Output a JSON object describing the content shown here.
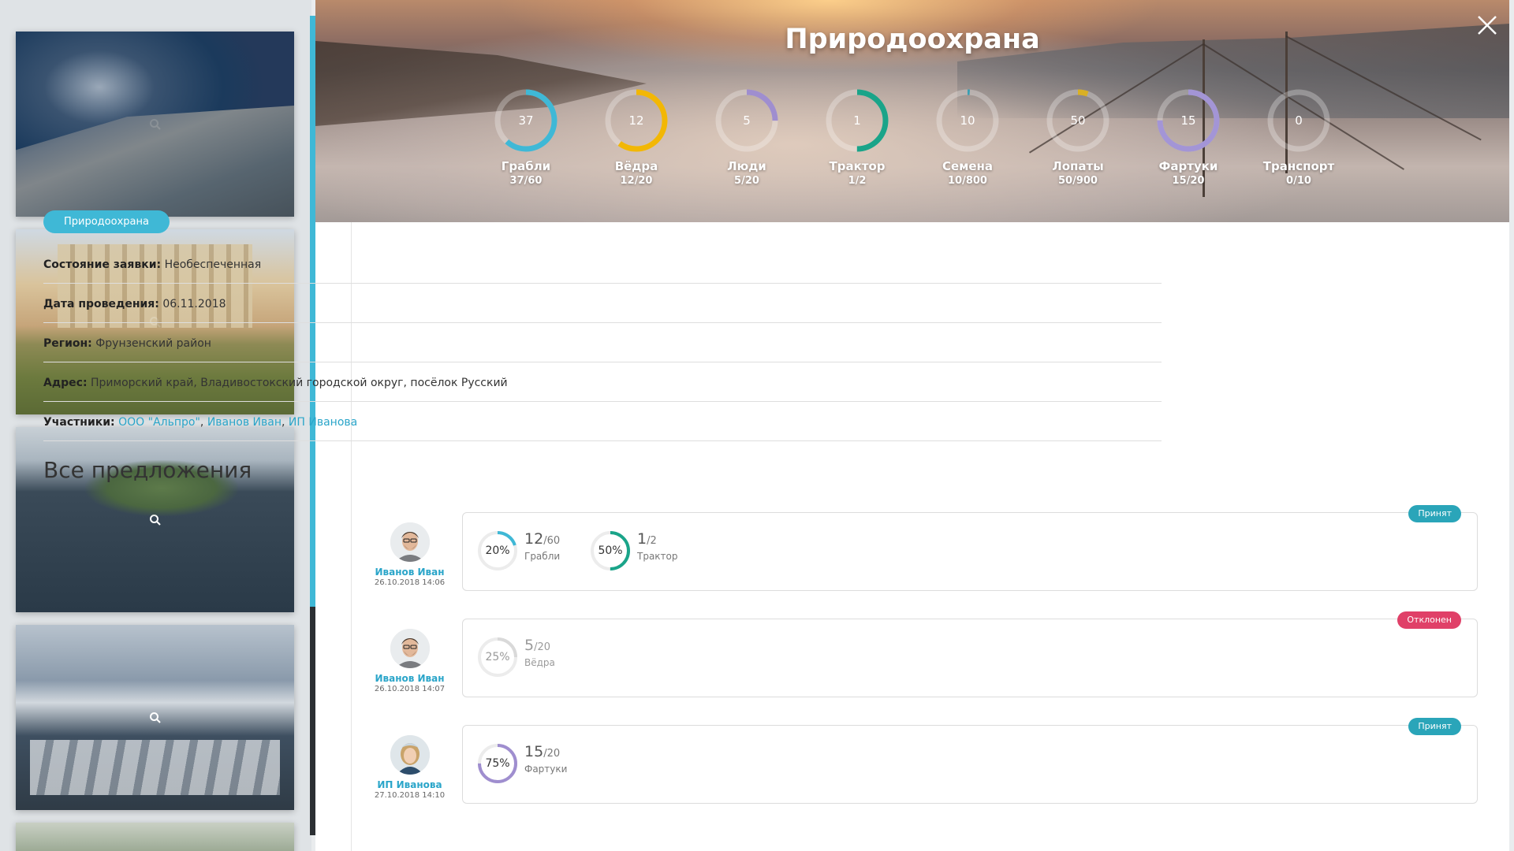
{
  "modal": {
    "title": "Природоохрана",
    "category_tag": "Природоохрана"
  },
  "resources": [
    {
      "name": "Грабли",
      "value": 37,
      "ratio": "37/60",
      "color": "#3fb8d6",
      "fraction": 0.6167
    },
    {
      "name": "Вёдра",
      "value": 12,
      "ratio": "12/20",
      "color": "#f2b705",
      "fraction": 0.6
    },
    {
      "name": "Люди",
      "value": 5,
      "ratio": "5/20",
      "color": "#9f8ecf",
      "fraction": 0.25
    },
    {
      "name": "Трактор",
      "value": 1,
      "ratio": "1/2",
      "color": "#1aa489",
      "fraction": 0.5
    },
    {
      "name": "Семена",
      "value": 10,
      "ratio": "10/800",
      "color": "#3a9fb3",
      "fraction": 0.0125
    },
    {
      "name": "Лопаты",
      "value": 50,
      "ratio": "50/900",
      "color": "#d9b024",
      "fraction": 0.0556
    },
    {
      "name": "Фартуки",
      "value": 15,
      "ratio": "15/20",
      "color": "#a395d6",
      "fraction": 0.75
    },
    {
      "name": "Транспорт",
      "value": 0,
      "ratio": "0/10",
      "color": "#1aa489",
      "fraction": 0
    }
  ],
  "info": {
    "status_label": "Состояние заявки:",
    "status_value": "Необеспеченная",
    "date_label": "Дата проведения:",
    "date_value": "06.11.2018",
    "region_label": "Регион:",
    "region_value": "Фрунзенский район",
    "address_label": "Адрес:",
    "address_value": "Приморский край, Владивостокский городской округ, посёлок Русский",
    "participants_label": "Участники:",
    "participants": [
      "ООО \"Альпро\"",
      "Иванов Иван",
      "ИП Иванова"
    ],
    "participants_sep": ","
  },
  "proposals_title": "Все предложения",
  "proposals": [
    {
      "user": "Иванов Иван",
      "date": "26.10.2018 14:06",
      "status": "Принят",
      "items": [
        {
          "pct": "20%",
          "value": "12",
          "total": "/60",
          "resource": "Грабли",
          "color": "#3fb8d6",
          "fraction": 0.2
        },
        {
          "pct": "50%",
          "value": "1",
          "total": "/2",
          "resource": "Трактор",
          "color": "#1aa489",
          "fraction": 0.5
        }
      ]
    },
    {
      "user": "Иванов Иван",
      "date": "26.10.2018 14:07",
      "status": "Отклонен",
      "items": [
        {
          "pct": "25%",
          "value": "5",
          "total": "/20",
          "resource": "Вёдра",
          "color": "#d9d9d9",
          "fraction": 0.25
        }
      ]
    },
    {
      "user": "ИП Иванова",
      "date": "27.10.2018 14:10",
      "status": "Принят",
      "items": [
        {
          "pct": "75%",
          "value": "15",
          "total": "/20",
          "resource": "Фартуки",
          "color": "#9f8ecf",
          "fraction": 0.75
        }
      ]
    }
  ],
  "icons": {
    "close": "close-icon",
    "zoom": "magnifier-icon"
  }
}
